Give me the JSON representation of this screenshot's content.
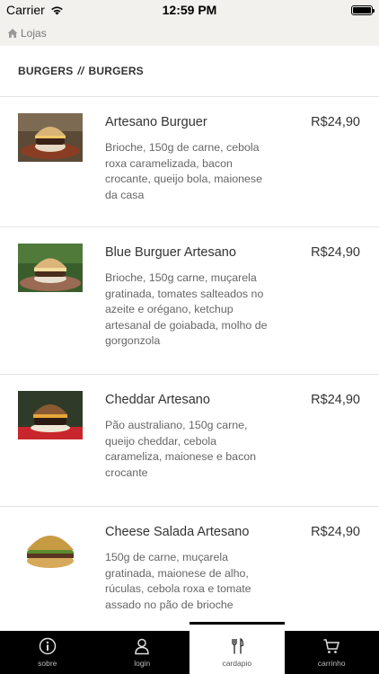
{
  "status_bar": {
    "carrier": "Carrier",
    "time": "12:59 PM"
  },
  "nav": {
    "back_label": "Lojas",
    "icon": "home-icon"
  },
  "section": {
    "category": "BURGERS",
    "separator": "//",
    "subcategory": "BURGERS"
  },
  "menu": {
    "items": [
      {
        "name": "Artesano Burguer",
        "price": "R$24,90",
        "description": "Brioche, 150g de carne, cebola roxa caramelizada, bacon crocante, queijo bola, maionese da casa"
      },
      {
        "name": "Blue Burguer Artesano",
        "price": "R$24,90",
        "description": "Brioche, 150g carne, muçarela gratinada, tomates salteados no azeite e orégano, ketchup artesanal de goiabada, molho de gorgonzola"
      },
      {
        "name": "Cheddar Artesano",
        "price": "R$24,90",
        "description": "Pão australiano, 150g carne, queijo cheddar, cebola carameliza, maionese e bacon crocante"
      },
      {
        "name": "Cheese Salada Artesano",
        "price": "R$24,90",
        "description": "150g de carne, muçarela gratinada, maionese de alho, rúculas, cebola roxa e tomate assado no pão de brioche"
      }
    ]
  },
  "tabs": [
    {
      "label": "sobre",
      "icon": "info-icon"
    },
    {
      "label": "login",
      "icon": "user-icon"
    },
    {
      "label": "cardapio",
      "icon": "cutlery-icon",
      "active": true
    },
    {
      "label": "carrinho",
      "icon": "cart-icon"
    }
  ],
  "colors": {
    "chrome_bg": "#f2f1ee",
    "tab_bar_bg": "#000000",
    "active_tab_bg": "#ffffff",
    "text_primary": "#333333",
    "text_secondary": "#666666"
  }
}
